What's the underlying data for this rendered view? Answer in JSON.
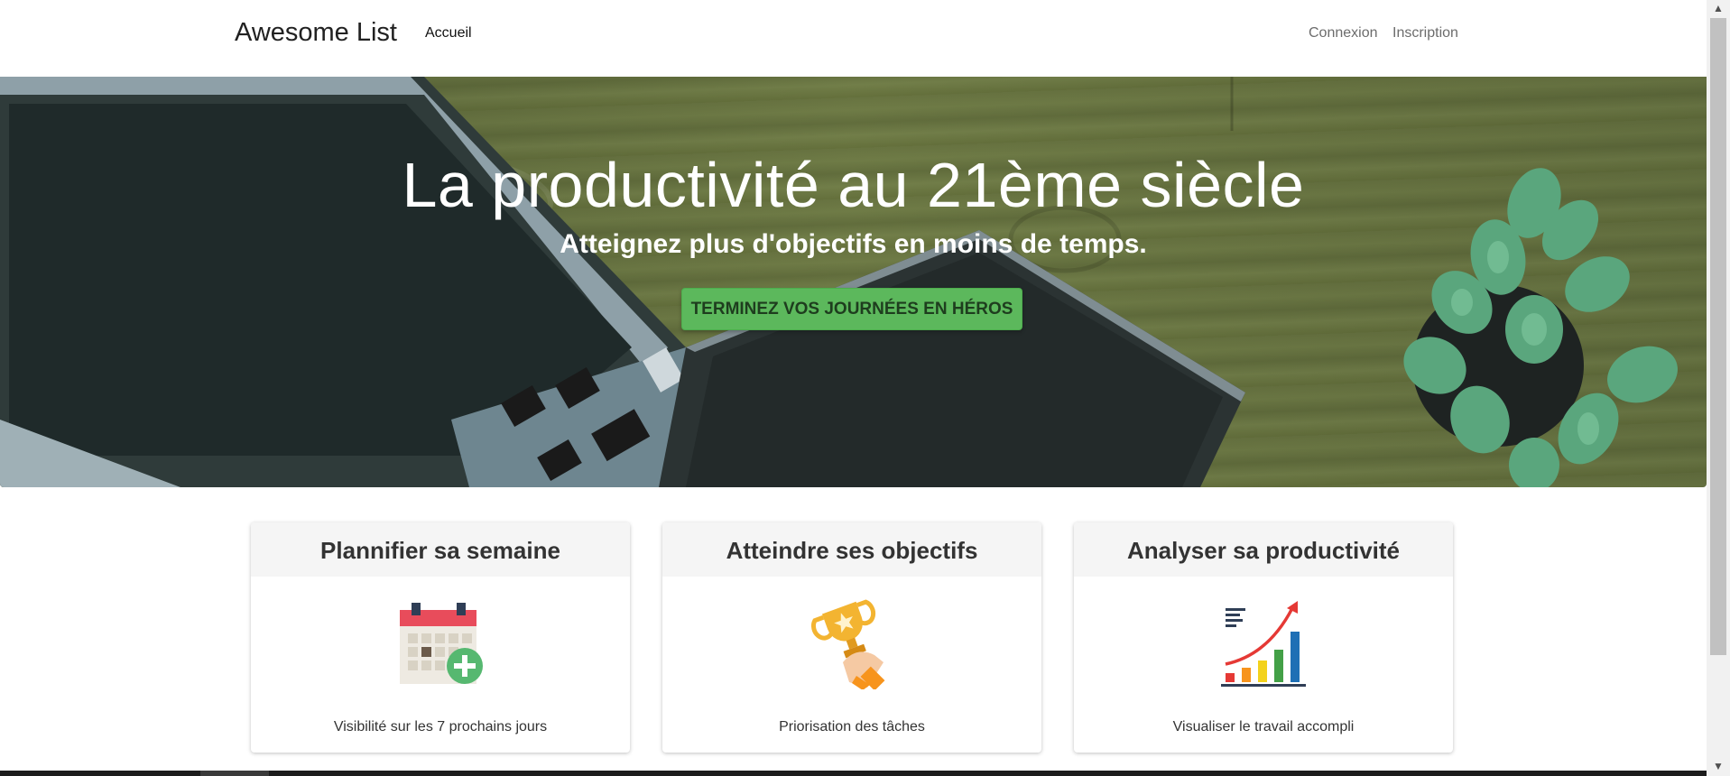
{
  "navbar": {
    "brand": "Awesome List",
    "home_link": "Accueil",
    "login_link": "Connexion",
    "signup_link": "Inscription"
  },
  "hero": {
    "title": "La productivité au 21ème siècle",
    "subtitle": "Atteignez plus d'objectifs en moins de temps.",
    "cta_label": "TERMINEZ VOS JOURNÉES EN HÉROS",
    "cta_color": "#5cb85c"
  },
  "features": [
    {
      "title": "Plannifier sa semaine",
      "icon": "calendar-add-icon",
      "text": "Visibilité sur les 7 prochains jours"
    },
    {
      "title": "Atteindre ses objectifs",
      "icon": "trophy-icon",
      "text": "Priorisation des tâches"
    },
    {
      "title": "Analyser sa productivité",
      "icon": "growth-chart-icon",
      "text": "Visualiser le travail accompli"
    }
  ],
  "colors": {
    "card_header_bg": "#f5f5f5",
    "calendar_red": "#e84c5b",
    "plus_green": "#56b870",
    "trophy_gold": "#f3b431",
    "chart_red": "#e53935"
  }
}
